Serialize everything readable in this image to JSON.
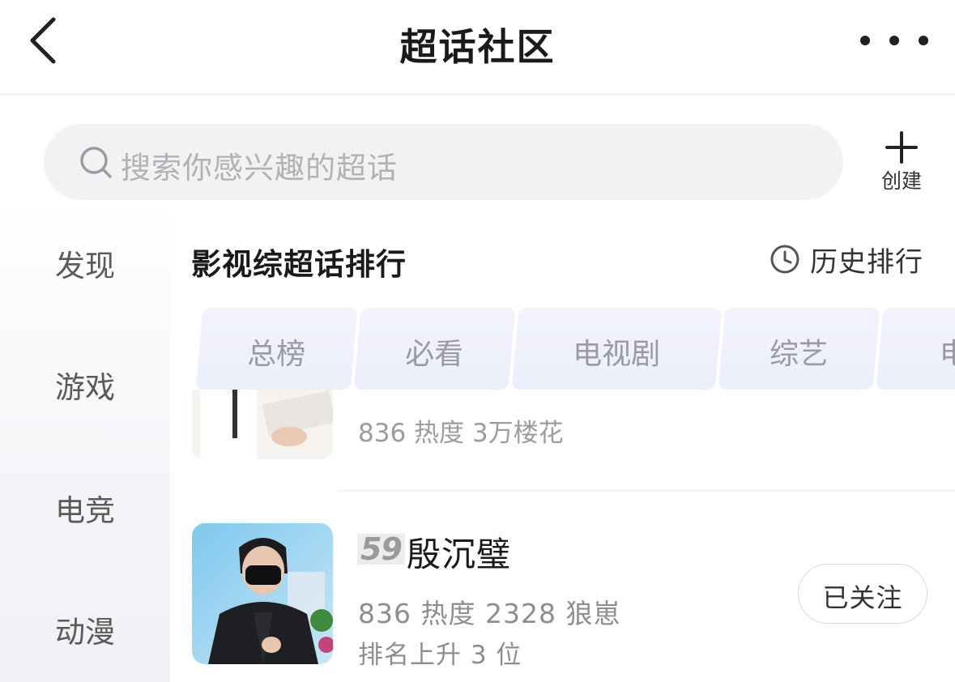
{
  "header": {
    "title": "超话社区",
    "back_icon": "chevron-left-icon",
    "more_icon": "more-horizontal-icon"
  },
  "search": {
    "placeholder": "搜索你感兴趣的超话",
    "icon": "search-icon"
  },
  "create": {
    "label": "创建",
    "icon": "plus-icon"
  },
  "sidebar": {
    "items": [
      {
        "label": "发现"
      },
      {
        "label": "游戏"
      },
      {
        "label": "电竞"
      },
      {
        "label": "动漫"
      }
    ]
  },
  "section": {
    "title": "影视综超话排行",
    "history_label": "历史排行",
    "history_icon": "clock-icon"
  },
  "tabs": [
    {
      "label": "总榜"
    },
    {
      "label": "必看"
    },
    {
      "label": "电视剧"
    },
    {
      "label": "综艺"
    },
    {
      "label": "电"
    }
  ],
  "list": {
    "previous_item": {
      "stats": "836 热度 3万楼花"
    },
    "item": {
      "rank": "59",
      "name": "殷沉璧",
      "stats": "836 热度 2328 狼崽",
      "trend": "排名上升 3 位",
      "follow_label": "已关注"
    }
  },
  "colors": {
    "tab_bg": "#eef0fc",
    "tab_text": "#9a9aa4",
    "search_bg": "#f2f2f4"
  }
}
